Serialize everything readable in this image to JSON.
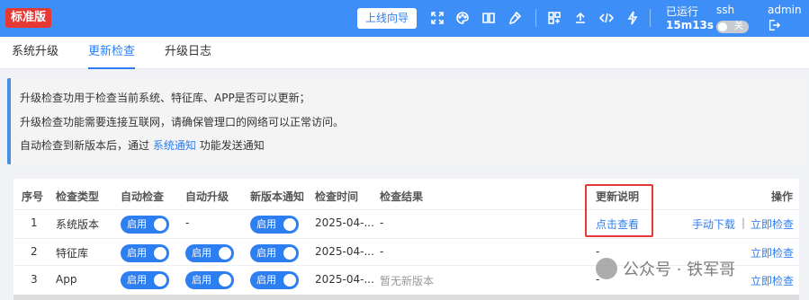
{
  "header": {
    "edition": "标准版",
    "guide_button": "上线向导",
    "run_label": "已运行",
    "run_time": "15m13s",
    "ssh_label": "ssh",
    "ssh_state": "关",
    "user": "admin",
    "icons": [
      "fullscreen-icon",
      "palette-icon",
      "book-icon",
      "clean-icon",
      "apps-icon",
      "upgrade-icon",
      "code-icon",
      "flash-icon",
      "logout-icon"
    ]
  },
  "tabs": [
    {
      "label": "系统升级",
      "active": false
    },
    {
      "label": "更新检查",
      "active": true
    },
    {
      "label": "升级日志",
      "active": false
    }
  ],
  "info": {
    "line1": "升级检查功用于检查当前系统、特征库、APP是否可以更新；",
    "line2": "升级检查功能需要连接互联网，请确保管理口的网络可以正常访问。",
    "line3_prefix": "自动检查到新版本后，通过",
    "line3_link": "系统通知",
    "line3_suffix": "功能发送通知"
  },
  "table": {
    "headers": {
      "index": "序号",
      "type": "检查类型",
      "auto_check": "自动检查",
      "auto_upgrade": "自动升级",
      "notify": "新版本通知",
      "time": "检查时间",
      "result": "检查结果",
      "notes": "更新说明",
      "ops": "操作"
    },
    "switch_on_label": "启用",
    "rows": [
      {
        "index": "1",
        "type": "系统版本",
        "auto_upgrade": "-",
        "time": "2025-04-...",
        "result": "-",
        "notes": "点击查看",
        "op_download": "手动下载",
        "op_sep": "|",
        "op_check": "立即检查"
      },
      {
        "index": "2",
        "type": "特征库",
        "time": "2025-04-...",
        "result": "-",
        "notes": "-",
        "op_check": "立即检查"
      },
      {
        "index": "3",
        "type": "App",
        "time": "2025-04-...",
        "result": "暂无新版本",
        "notes": "-",
        "op_check": "立即检查"
      }
    ]
  },
  "watermark": "公众号 · 铁军哥",
  "colors": {
    "primary": "#3e8ef7",
    "accent": "#2d7ef0",
    "edition": "#e53935",
    "highlight": "#e53935"
  }
}
